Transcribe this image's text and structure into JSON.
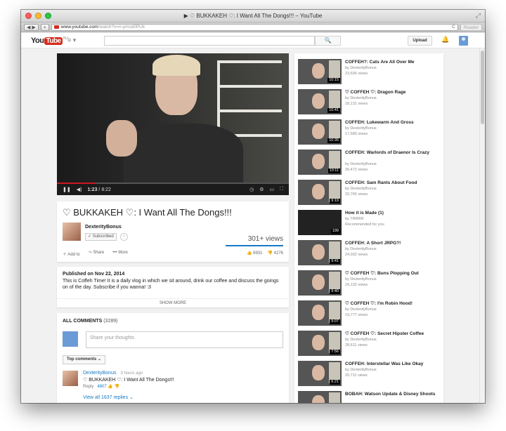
{
  "browser": {
    "window_title": "▶ ♡ BUKKAKEH ♡: I Want All The Dongs!!! – YouTube",
    "url_host": "www.youtube.com",
    "url_path": "/watch?v=n-ymsd0PUk",
    "reader_label": "Reader",
    "back": "◀",
    "forward": "▶",
    "new_tab": "+",
    "reload": "C"
  },
  "header": {
    "logo_you": "You",
    "logo_tube": "Tube",
    "logo_region": "HU",
    "guide_icon": "≡ ▾",
    "search_icon": "🔍",
    "upload_label": "Upload",
    "bell_icon": "🔔"
  },
  "player": {
    "current_time": "1:23",
    "duration": "8:22",
    "progress": 0.165
  },
  "video": {
    "title": "♡ BUKKAKEH ♡: I Want All The Dongs!!!",
    "channel": "DexterityBonus",
    "subscribed_label": "✓ Subscribed",
    "views": "301+ views",
    "add_to": "Add to",
    "share": "Share",
    "more": "More",
    "likes": "6931",
    "dislikes": "4276"
  },
  "description": {
    "published": "Published on Nov 22, 2014",
    "text": "This is Coffeh Time! It is a daily vlog in which we sit around, drink our coffee and discuss the goings on of the day. Subscribe if you wanna! :3",
    "show_more": "SHOW MORE"
  },
  "comments": {
    "header_label": "ALL COMMENTS",
    "count": "(3289)",
    "placeholder": "Share your thoughts",
    "sort_label": "Top comments",
    "first": {
      "author": "DexterityBonus",
      "time": "3 hours ago",
      "text": "♡ BUKKAKEH ♡: I Want All The Dongs!!!",
      "reply": "Reply",
      "likes": "4807"
    },
    "view_all": "View all 1637 replies"
  },
  "related": [
    {
      "title": "COFFEH?: Cats Are All Over Me",
      "channel": "by DexterityBonus",
      "views": "23,696 views",
      "duration": "10:15"
    },
    {
      "title": "♡ COFFEH ♡: Dragon Rage",
      "channel": "by DexterityBonus",
      "views": "18,131 views",
      "duration": "10:41"
    },
    {
      "title": "COFFEH: Lukewarm And Gross",
      "channel": "by DexterityBonus",
      "views": "17,580 views",
      "duration": "10:35"
    },
    {
      "title": "COFFEH: Warlords of Draenor Is Crazy",
      "channel": "by DexterityBonus",
      "views": "30,472 views",
      "duration": "10:11"
    },
    {
      "title": "COFFEH: Sam Rants About Food",
      "channel": "by DexterityBonus",
      "views": "32,765 views",
      "duration": "9:19"
    },
    {
      "title": "How it is Made (1)",
      "channel": "by TRRRR",
      "views": "Recommended for you",
      "duration": "199"
    },
    {
      "title": "COFFEH: A Short JRPG?!",
      "channel": "by DexterityBonus",
      "views": "24,032 views",
      "duration": "9:41"
    },
    {
      "title": "♡ COFFEH ♡: Buns Plopping Out",
      "channel": "by DexterityBonus",
      "views": "24,132 views",
      "duration": "9:40"
    },
    {
      "title": "♡ COFFEH ♡: I'm Robin Hood!",
      "channel": "by DexterityBonus",
      "views": "19,777 views",
      "duration": "9:07"
    },
    {
      "title": "♡ COFFEH ♡: Secret Hipster Coffee",
      "channel": "by DexterityBonus",
      "views": "28,611 views",
      "duration": "7:56"
    },
    {
      "title": "COFFEH: Interstellar Was Like Okay",
      "channel": "by DexterityBonus",
      "views": "20,711 views",
      "duration": "6:21"
    },
    {
      "title": "BOBAH: Watson Update & Disney Shoots",
      "channel": "",
      "views": "",
      "duration": ""
    }
  ],
  "colors": {
    "brand_red": "#d52b1e",
    "link_blue": "#167ac6"
  }
}
